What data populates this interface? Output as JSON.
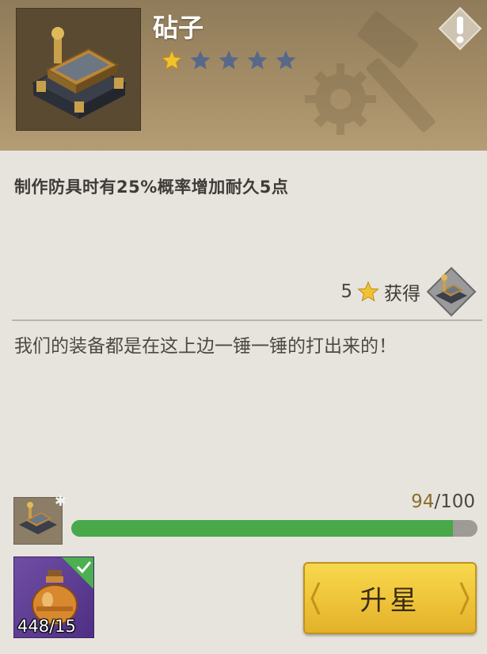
{
  "header": {
    "title": "砧子",
    "stars_filled": 1,
    "stars_total": 5,
    "thumbnail_icon": "anvil-workbench-icon",
    "watermark_icon": "hammer-gear-icon",
    "info_icon": "exclamation-icon"
  },
  "effect": {
    "text": "制作防具时有25%概率增加耐久5点"
  },
  "obtain": {
    "count": "5",
    "label": "获得",
    "icon": "anvil-workbench-icon"
  },
  "description": {
    "text": "我们的装备都是在这上边一锤一锤的打出来的！"
  },
  "progress": {
    "current": "94",
    "separator": "/",
    "max": "100",
    "fraction": 0.94
  },
  "material": {
    "count": "448/15",
    "icon": "potion-bottle-icon",
    "checked": true
  },
  "upgrade_button": {
    "label": "升星"
  },
  "colors": {
    "header_bg": "#a48d66",
    "star_filled": "#f2c12e",
    "star_empty": "#58688a",
    "progress_fill": "#48a84a",
    "button_gold": "#efc53a",
    "material_bg": "#5e3f96"
  }
}
